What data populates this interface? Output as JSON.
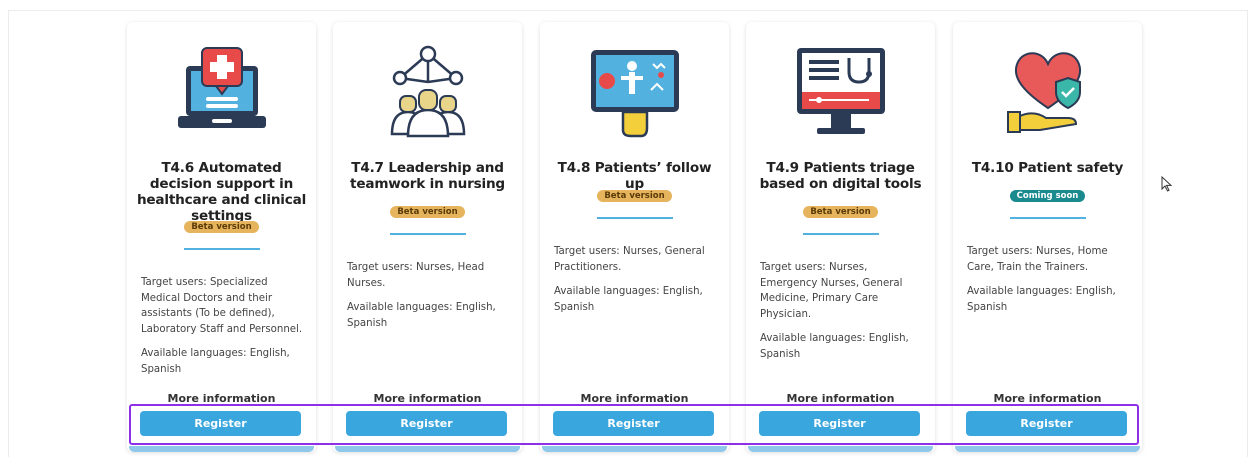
{
  "cards": [
    {
      "icon": "computer-medical-alert-icon",
      "title": "T4.6 Automated decision support in healthcare and clinical settings",
      "badge": "Beta version",
      "target_users": "Target users: Specialized Medical Doctors and their assistants (To be defined), Laboratory Staff and Personnel.",
      "languages": "Available languages: English, Spanish",
      "more_info": "More information",
      "register": "Register"
    },
    {
      "icon": "team-network-nurses-icon",
      "title": "T4.7 Leadership and teamwork in nursing",
      "badge": "Beta version",
      "target_users": "Target users: Nurses, Head Nurses.",
      "languages": "Available languages: English, Spanish",
      "more_info": "More information",
      "register": "Register"
    },
    {
      "icon": "tablet-patient-health-icon",
      "title": "T4.8 Patients’ follow up",
      "badge": "Beta version",
      "target_users": "Target users: Nurses, General Practitioners.",
      "languages": "Available languages: English, Spanish",
      "more_info": "More information",
      "register": "Register"
    },
    {
      "icon": "monitor-stethoscope-icon",
      "title": "T4.9 Patients triage based on digital tools",
      "badge": "Beta version",
      "target_users": "Target users: Nurses, Emergency Nurses, General Medicine, Primary Care Physician.",
      "languages": "Available languages: English, Spanish",
      "more_info": "More information",
      "register": "Register"
    },
    {
      "icon": "heart-shield-hand-icon",
      "title": "T4.10 Patient safety",
      "badge": "Coming soon",
      "target_users": "Target users: Nurses, Home Care, Train the Trainers.",
      "languages": "Available languages: English, Spanish",
      "more_info": "More information",
      "register": "Register"
    }
  ],
  "colors": {
    "register_button": "#3aa6de",
    "beta_badge": "#e6b45c",
    "coming_soon_badge": "#1b8a8e",
    "highlight": "#8d30e8",
    "divider": "#53b1e0"
  }
}
